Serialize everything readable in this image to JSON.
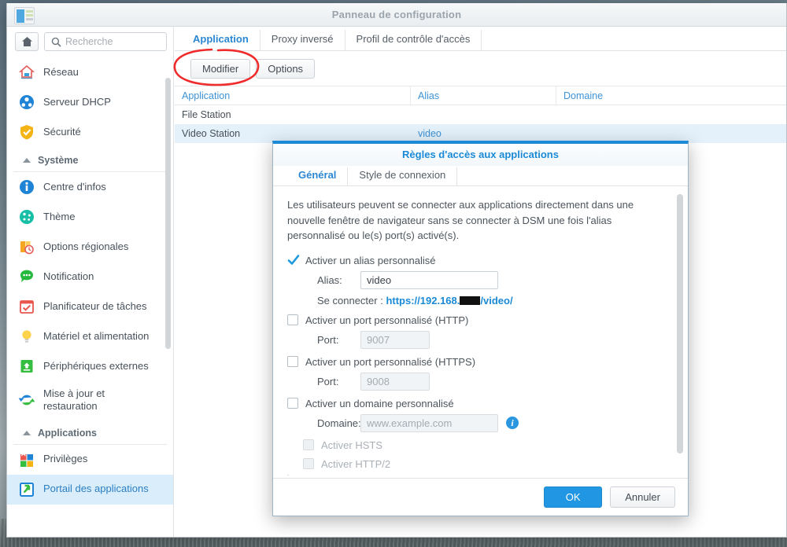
{
  "window": {
    "title": "Panneau de configuration",
    "icon": "control-panel-icon"
  },
  "sidebar": {
    "home_icon": "home-icon",
    "search": {
      "placeholder": "Recherche",
      "value": "",
      "icon": "search-icon"
    },
    "items": [
      {
        "label": "Réseau",
        "icon": "network-home-icon",
        "type": "item",
        "selected": false
      },
      {
        "label": "Serveur DHCP",
        "icon": "dhcp-server-icon",
        "type": "item",
        "selected": false
      },
      {
        "label": "Sécurité",
        "icon": "security-shield-icon",
        "type": "item",
        "selected": false
      },
      {
        "label": "Système",
        "icon": "chevron-up-icon",
        "type": "group"
      },
      {
        "label": "Centre d'infos",
        "icon": "info-center-icon",
        "type": "item",
        "selected": false
      },
      {
        "label": "Thème",
        "icon": "theme-palette-icon",
        "type": "item",
        "selected": false
      },
      {
        "label": "Options régionales",
        "icon": "regional-options-icon",
        "type": "item",
        "selected": false
      },
      {
        "label": "Notification",
        "icon": "notification-icon",
        "type": "item",
        "selected": false
      },
      {
        "label": "Planificateur de tâches",
        "icon": "task-scheduler-icon",
        "type": "item",
        "selected": false
      },
      {
        "label": "Matériel et alimentation",
        "icon": "hardware-power-icon",
        "type": "item",
        "selected": false
      },
      {
        "label": "Périphériques externes",
        "icon": "external-devices-icon",
        "type": "item",
        "selected": false
      },
      {
        "label": "Mise à jour et restauration",
        "icon": "update-restore-icon",
        "type": "item",
        "selected": false
      },
      {
        "label": "Applications",
        "icon": "chevron-up-icon",
        "type": "group"
      },
      {
        "label": "Privilèges",
        "icon": "privileges-icon",
        "type": "item",
        "selected": false
      },
      {
        "label": "Portail des applications",
        "icon": "application-portal-icon",
        "type": "item",
        "selected": true
      }
    ]
  },
  "main": {
    "tabs": [
      {
        "label": "Application",
        "active": true
      },
      {
        "label": "Proxy inversé",
        "active": false
      },
      {
        "label": "Profil de contrôle d'accès",
        "active": false
      }
    ],
    "toolbar": {
      "edit_label": "Modifier",
      "options_label": "Options"
    },
    "table": {
      "columns": [
        "Application",
        "Alias",
        "Domaine"
      ],
      "rows": [
        {
          "application": "File Station",
          "alias": "",
          "domaine": "",
          "selected": false
        },
        {
          "application": "Video Station",
          "alias": "video",
          "domaine": "",
          "selected": true
        }
      ]
    },
    "annotation": {
      "shape": "red-ellipse",
      "target": "Modifier",
      "color": "#ef2b2b"
    }
  },
  "dialog": {
    "title": "Règles d'accès aux applications",
    "tabs": [
      {
        "label": "Général",
        "active": true
      },
      {
        "label": "Style de connexion",
        "active": false
      }
    ],
    "intro": "Les utilisateurs peuvent se connecter aux applications directement dans une nouvelle fenêtre de navigateur sans se connecter à DSM une fois l'alias personnalisé ou le(s) port(s) activé(s).",
    "fields": {
      "alias_checkbox_label": "Activer un alias personnalisé",
      "alias_checked": true,
      "alias_label": "Alias:",
      "alias_value": "video",
      "connect_label": "Se connecter :",
      "connect_url_prefix": "https://192.168.",
      "connect_url_suffix": "/video/",
      "http_port_checkbox_label": "Activer un port personnalisé (HTTP)",
      "http_port_checked": false,
      "http_port_label": "Port:",
      "http_port_value": "9007",
      "https_port_checkbox_label": "Activer un port personnalisé (HTTPS)",
      "https_port_checked": false,
      "https_port_label": "Port:",
      "https_port_value": "9008",
      "domain_checkbox_label": "Activer un domaine personnalisé",
      "domain_checked": false,
      "domain_label": "Domaine:",
      "domain_placeholder": "www.example.com",
      "domain_info_icon": "info-icon",
      "hsts_label": "Activer HSTS",
      "hsts_checked": false,
      "http2_label": "Activer HTTP/2",
      "http2_checked": false
    },
    "footer": {
      "ok_label": "OK",
      "cancel_label": "Annuler"
    }
  },
  "colors": {
    "accent": "#1b8ad6",
    "link": "#3d93d6",
    "selected_row": "#e4f1fb",
    "annotation_red": "#ef2b2b"
  }
}
